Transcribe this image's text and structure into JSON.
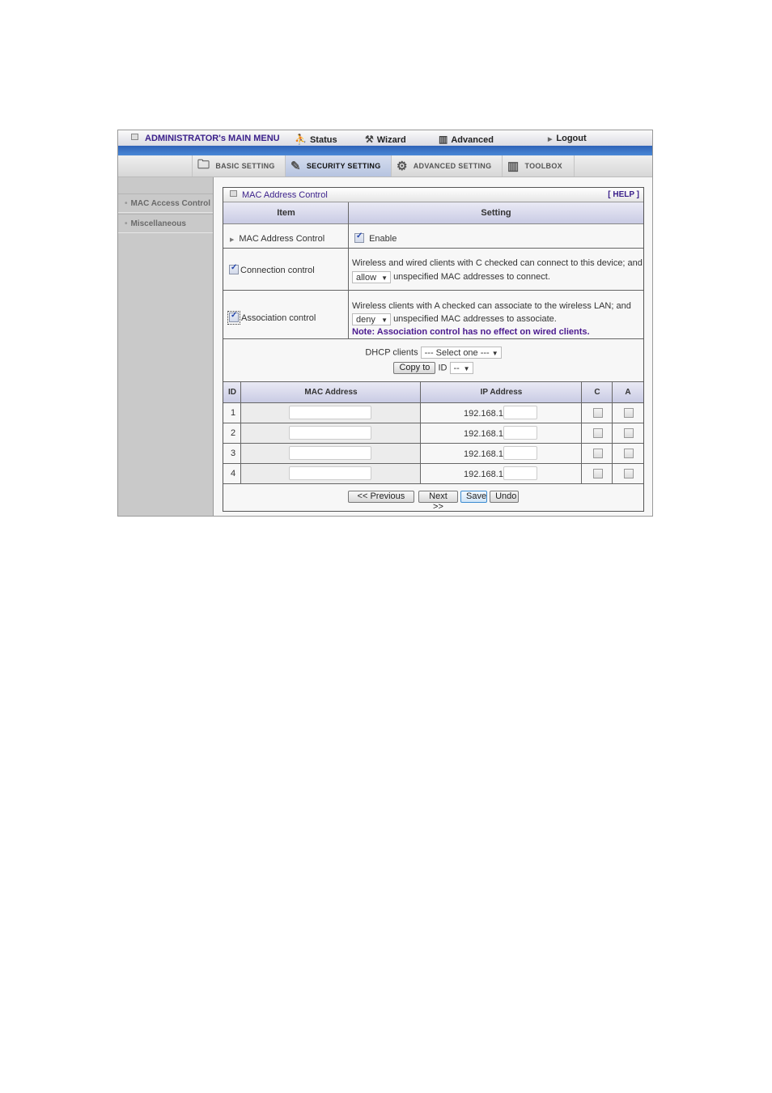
{
  "topmenu": {
    "title": "ADMINISTRATOR's MAIN MENU",
    "items": [
      {
        "label": "Status",
        "icon": "status-icon"
      },
      {
        "label": "Wizard",
        "icon": "wizard-icon"
      },
      {
        "label": "Advanced",
        "icon": "advanced-icon"
      },
      {
        "label": "Logout",
        "icon": "arrow-right-icon"
      }
    ]
  },
  "tabs": [
    {
      "label": "BASIC SETTING",
      "icon": "folder-icon",
      "active": false
    },
    {
      "label": "SECURITY SETTING",
      "icon": "security-icon",
      "active": true
    },
    {
      "label": "ADVANCED SETTING",
      "icon": "gear-icon",
      "active": false
    },
    {
      "label": "TOOLBOX",
      "icon": "toolbox-icon",
      "active": false
    }
  ],
  "sidebar": {
    "items": [
      {
        "label": "MAC Access Control"
      },
      {
        "label": "Miscellaneous"
      }
    ]
  },
  "panel": {
    "title": "MAC Address Control",
    "help": "[ HELP ]",
    "headers": {
      "item": "Item",
      "setting": "Setting"
    },
    "mac_control": {
      "label": "MAC Address Control",
      "enable_label": "Enable",
      "enabled": true
    },
    "connection": {
      "label": "Connection control",
      "checked": true,
      "line1": "Wireless and wired clients with C checked can connect to this device; and",
      "select_value": "allow",
      "line2": "unspecified MAC addresses to connect."
    },
    "association": {
      "label": "Association control",
      "checked": true,
      "line1": "Wireless clients with A checked can associate to the wireless LAN; and",
      "select_value": "deny",
      "line2": "unspecified MAC addresses to associate.",
      "note": "Note: Association control has no effect on wired clients."
    },
    "dhcp": {
      "label": "DHCP clients",
      "select_value": "--- Select one ---",
      "copy_button": "Copy to",
      "id_label": "ID",
      "id_value": "--"
    },
    "table": {
      "headers": [
        "ID",
        "MAC Address",
        "IP Address",
        "C",
        "A"
      ],
      "ip_prefix": "192.168.1.",
      "rows": [
        {
          "id": "1",
          "mac": "",
          "ip_suffix": "",
          "c": false,
          "a": false
        },
        {
          "id": "2",
          "mac": "",
          "ip_suffix": "",
          "c": false,
          "a": false
        },
        {
          "id": "3",
          "mac": "",
          "ip_suffix": "",
          "c": false,
          "a": false
        },
        {
          "id": "4",
          "mac": "",
          "ip_suffix": "",
          "c": false,
          "a": false
        }
      ]
    },
    "buttons": {
      "previous": "<< Previous",
      "next": "Next >>",
      "save": "Save",
      "undo": "Undo"
    }
  },
  "colors": {
    "accent": "#3a1f8a",
    "bluebar": "#3a72c8",
    "sidebar": "#c9c9c9"
  }
}
